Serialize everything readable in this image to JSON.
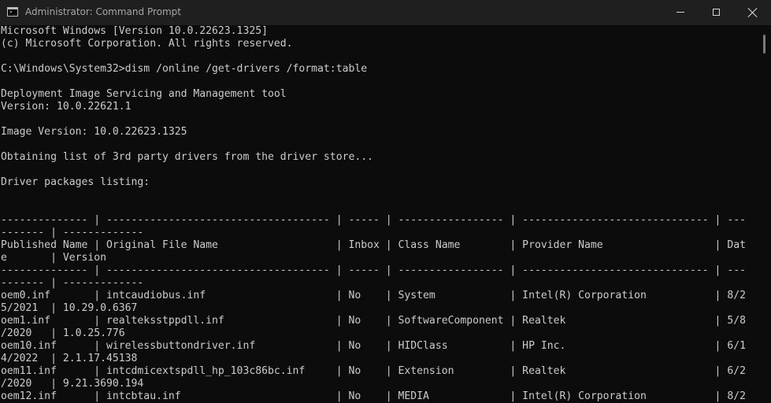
{
  "window": {
    "title": "Administrator: Command Prompt",
    "icon": "cmd-icon",
    "controls": [
      "minimize-icon",
      "maximize-icon",
      "close-icon"
    ]
  },
  "console": {
    "lines": [
      "Microsoft Windows [Version 10.0.22623.1325]",
      "(c) Microsoft Corporation. All rights reserved.",
      "",
      "C:\\Windows\\System32>dism /online /get-drivers /format:table",
      "",
      "Deployment Image Servicing and Management tool",
      "Version: 10.0.22621.1",
      "",
      "Image Version: 10.0.22623.1325",
      "",
      "Obtaining list of 3rd party drivers from the driver store...",
      "",
      "Driver packages listing:",
      "",
      "",
      "-------------- | ------------------------------------ | ----- | ----------------- | ------------------------------ | ---",
      "------- | -------------",
      "Published Name | Original File Name                   | Inbox | Class Name        | Provider Name                  | Dat",
      "e       | Version",
      "-------------- | ------------------------------------ | ----- | ----------------- | ------------------------------ | ---",
      "------- | -------------",
      "oem0.inf       | intcaudiobus.inf                     | No    | System            | Intel(R) Corporation           | 8/2",
      "5/2021  | 10.29.0.6367",
      "oem1.inf       | realteksstppdll.inf                  | No    | SoftwareComponent | Realtek                        | 5/8",
      "/2020   | 1.0.25.776",
      "oem10.inf      | wirelessbuttondriver.inf             | No    | HIDClass          | HP Inc.                        | 6/1",
      "4/2022  | 2.1.17.45138",
      "oem11.inf      | intcdmicextspdll_hp_103c86bc.inf     | No    | Extension         | Realtek                        | 6/2",
      "/2020   | 9.21.3690.194",
      "oem12.inf      | intcbtau.inf                         | No    | MEDIA             | Intel(R) Corporation           | 8/2"
    ]
  },
  "colors": {
    "console_bg": "#0c0c0c",
    "console_text": "#cccccc",
    "titlebar_bg": "#1f1f1f",
    "title_text": "#a6a6a6"
  }
}
